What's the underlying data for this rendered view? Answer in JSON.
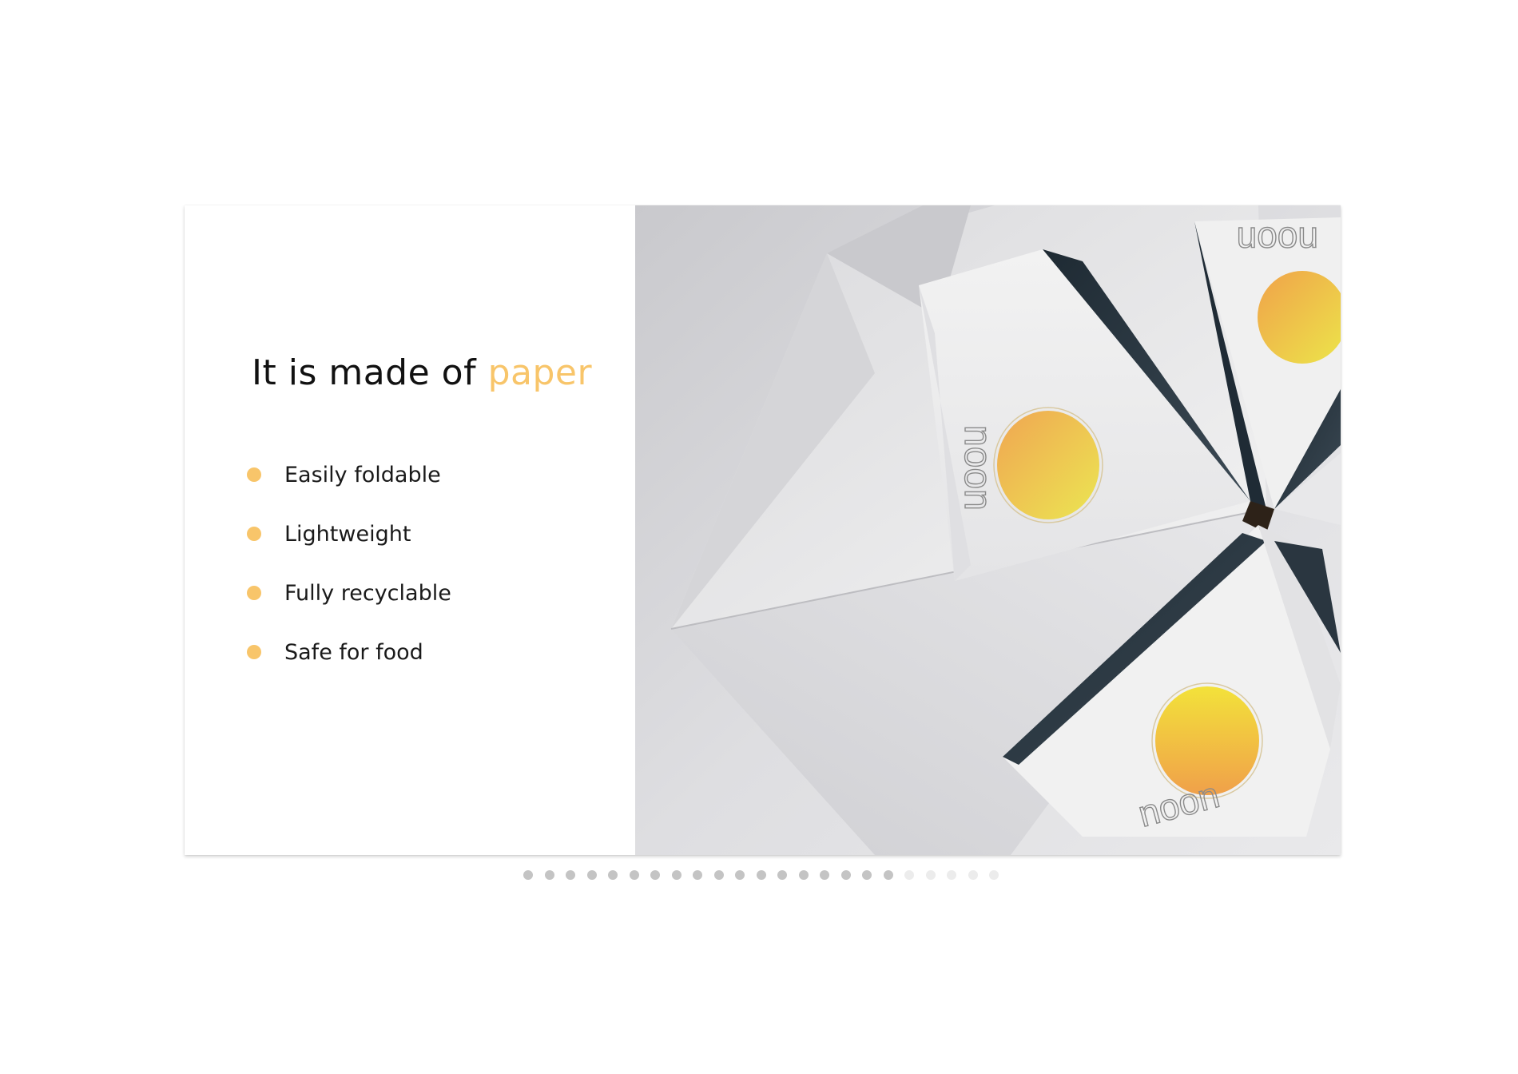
{
  "slide": {
    "title_main": "It is made of ",
    "title_accent": "paper",
    "features": [
      "Easily foldable",
      "Lightweight",
      "Fully recyclable",
      "Safe for food"
    ],
    "photo_logo_text": "noon"
  },
  "colors": {
    "accent": "#f8c56a",
    "text": "#111111",
    "dot_seen": "#c4c4c4",
    "dot_upcoming": "#ececec"
  },
  "pager": {
    "total_slides": 23,
    "current_slide": 18
  }
}
